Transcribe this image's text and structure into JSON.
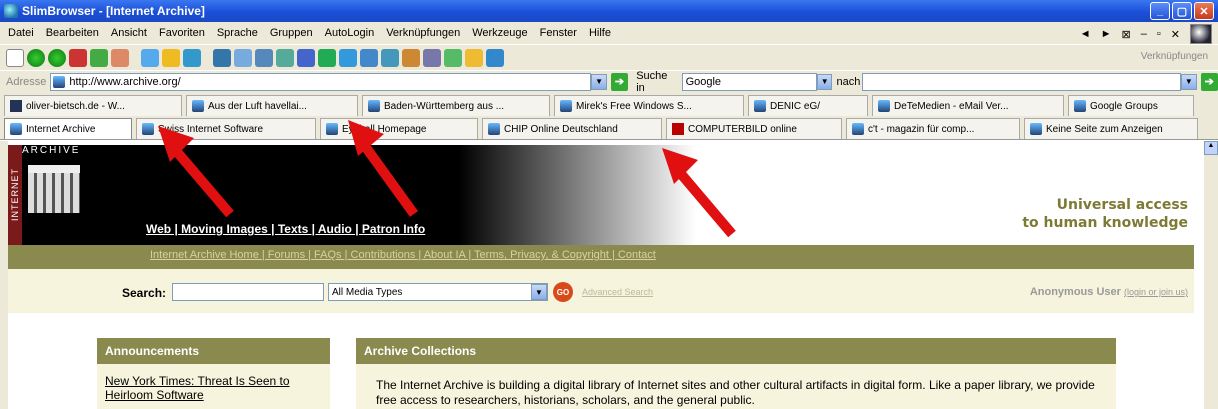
{
  "window": {
    "title": "SlimBrowser - [Internet Archive]",
    "controls": [
      "_",
      "▢",
      "✕"
    ]
  },
  "menubar": {
    "items": [
      "Datei",
      "Bearbeiten",
      "Ansicht",
      "Favoriten",
      "Sprache",
      "Gruppen",
      "AutoLogin",
      "Verknüpfungen",
      "Werkzeuge",
      "Fenster",
      "Hilfe"
    ],
    "right_controls": [
      "◄",
      "►",
      "⊠",
      "–",
      "▫",
      "✕"
    ]
  },
  "toolbar": {
    "links_label": "Verknüpfungen"
  },
  "addressbar": {
    "label": "Adresse",
    "url": "http://www.archive.org/",
    "search_in_label": "Suche in",
    "search_engine": "Google",
    "nach_label": "nach"
  },
  "tabs_row1": [
    "oliver-bietsch.de - W...",
    "Aus der Luft havellai...",
    "Baden-Württemberg aus ...",
    "Mirek's Free Windows S...",
    "DENIC eG/",
    "DeTeMedien - eMail Ver...",
    "Google Groups"
  ],
  "tabs_row2": [
    "Internet Archive",
    "Swiss Internet Software",
    "Eyeball Homepage",
    "CHIP Online Deutschland",
    "COMPUTERBILD online",
    "c't - magazin für comp...",
    "Keine Seite zum Anzeigen"
  ],
  "page": {
    "logo_vertical": "INTERNET",
    "logo_top": "ARCHIVE",
    "nav_links": "Web | Moving Images | Texts | Audio | Patron Info",
    "tagline_line1": "Universal access",
    "tagline_line2": "to human knowledge",
    "sub_links": "Internet Archive Home | Forums | FAQs | Contributions | About IA | Terms, Privacy, & Copyright | Contact",
    "search_label": "Search:",
    "media_type": "All Media Types",
    "go_label": "GO",
    "advanced_search": "Advanced Search",
    "user_label": "Anonymous User",
    "login_links": "(login or join us)",
    "announcements_title": "Announcements",
    "announcement_1": "New York Times: Threat Is Seen to Heirloom Software",
    "collections_title": "Archive Collections",
    "collections_text": "The Internet Archive is building a digital library of Internet sites and other cultural artifacts in digital form. Like a paper library, we provide free access to researchers, historians, scholars, and the general public."
  },
  "colors": {
    "titlebar": "#1a4fd8",
    "olive": "#8b8a4e",
    "arrow": "#e01010"
  }
}
